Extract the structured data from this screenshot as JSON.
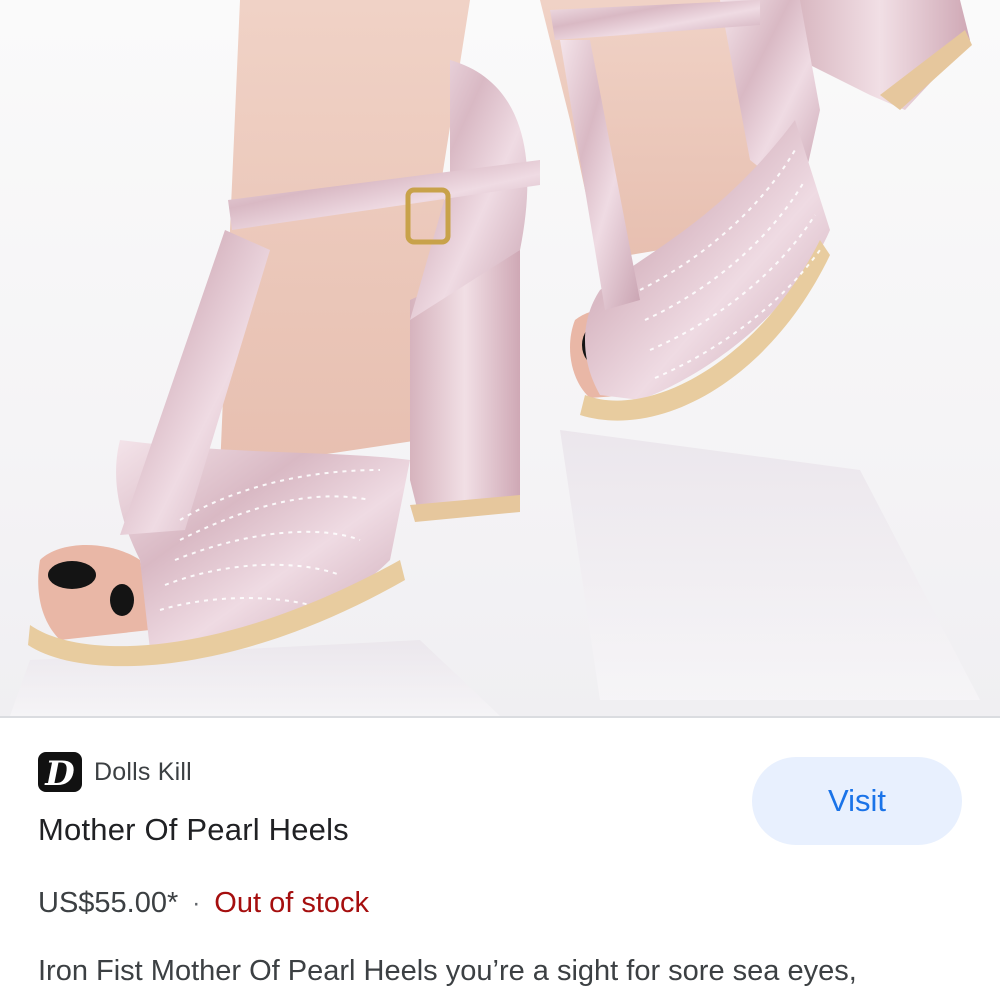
{
  "product": {
    "image_alt": "Mother Of Pearl Heels product photo",
    "source": {
      "name": "Dolls Kill",
      "logo_icon": "dolls-kill-logo-icon",
      "logo_letter": "D"
    },
    "title": "Mother Of Pearl Heels",
    "visit_label": "Visit",
    "price": "US$55.00*",
    "separator": "·",
    "stock_status": "Out of stock",
    "description": "Iron Fist Mother Of Pearl Heels you’re a sight for sore sea eyes,"
  },
  "colors": {
    "visit_bg": "#e8f0fe",
    "visit_text": "#1a73e8",
    "stock_text": "#a50e0e",
    "shoe_metallic": "#e8cfd6"
  }
}
